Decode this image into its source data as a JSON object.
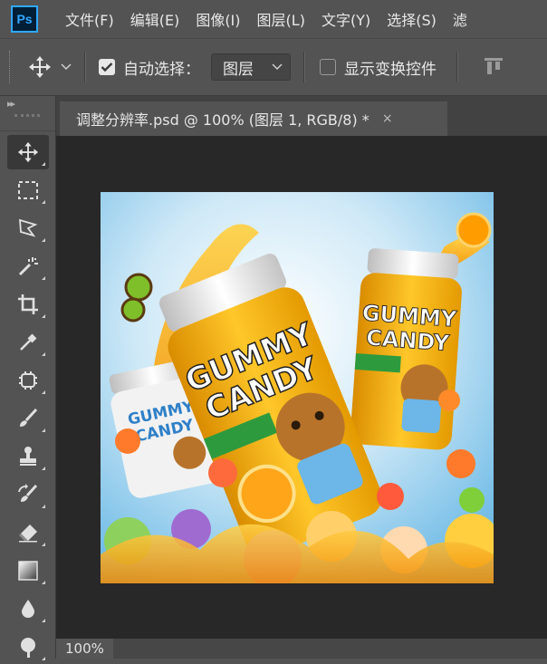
{
  "app": {
    "logo": "Ps"
  },
  "menubar": {
    "items": [
      {
        "label": "文件(F)"
      },
      {
        "label": "编辑(E)"
      },
      {
        "label": "图像(I)"
      },
      {
        "label": "图层(L)"
      },
      {
        "label": "文字(Y)"
      },
      {
        "label": "选择(S)"
      },
      {
        "label": "滤"
      }
    ]
  },
  "options_bar": {
    "tool_icon": "move-icon",
    "auto_select": {
      "checked": true,
      "label": "自动选择："
    },
    "select_value": "图层",
    "show_transform": {
      "checked": false,
      "label": "显示变换控件"
    }
  },
  "toolbar": {
    "tools": [
      {
        "name": "move-tool",
        "icon": "move-icon",
        "active": true
      },
      {
        "name": "marquee-tool",
        "icon": "rect-marquee-icon"
      },
      {
        "name": "lasso-tool",
        "icon": "polygon-lasso-icon"
      },
      {
        "name": "quick-select-tool",
        "icon": "magic-wand-icon"
      },
      {
        "name": "crop-tool",
        "icon": "crop-icon"
      },
      {
        "name": "eyedropper-tool",
        "icon": "eyedropper-icon"
      },
      {
        "name": "healing-tool",
        "icon": "healing-brush-icon"
      },
      {
        "name": "brush-tool",
        "icon": "brush-icon"
      },
      {
        "name": "stamp-tool",
        "icon": "clone-stamp-icon"
      },
      {
        "name": "history-brush-tool",
        "icon": "history-brush-icon"
      },
      {
        "name": "eraser-tool",
        "icon": "eraser-icon"
      },
      {
        "name": "gradient-tool",
        "icon": "gradient-icon"
      },
      {
        "name": "blur-tool",
        "icon": "blur-drop-icon"
      },
      {
        "name": "dodge-tool",
        "icon": "dodge-icon"
      }
    ]
  },
  "document": {
    "tab_title": "调整分辨率.psd @ 100% (图层 1, RGB/8) *",
    "close_glyph": "×",
    "zoom": "100%",
    "artwork": {
      "jar_main_line1": "GUMMY",
      "jar_main_line2": "CANDY",
      "jar_right_line1": "GUMMY",
      "jar_right_line2": "CANDY",
      "jar_left_line1": "GUMMY",
      "jar_left_line2": "CANDY"
    }
  },
  "colors": {
    "ui_bg": "#535353",
    "canvas_bg": "#282828",
    "sky": "#9fd3ee",
    "juice": "#f5a000",
    "jar_yellow": "#f2b515"
  }
}
